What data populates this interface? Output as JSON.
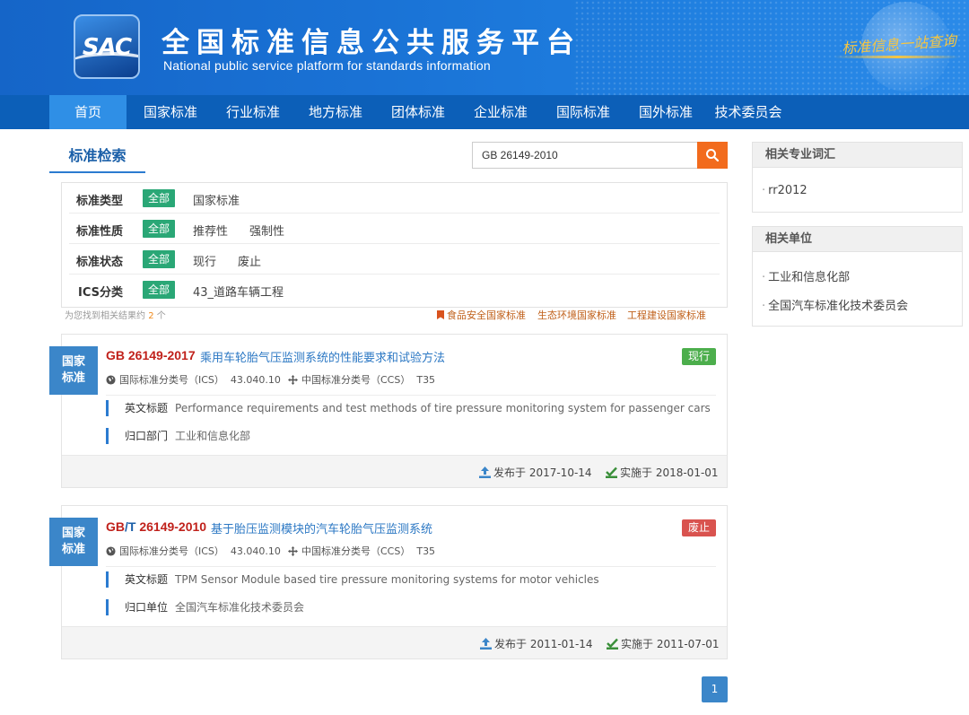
{
  "header": {
    "logo_text": "SAC",
    "title": "全国标准信息公共服务平台",
    "subtitle": "National public service platform  for standards information",
    "slogan": "标准信息一站查询"
  },
  "nav": {
    "items": [
      "首页",
      "国家标准",
      "行业标准",
      "地方标准",
      "团体标准",
      "企业标准",
      "国际标准",
      "国外标准",
      "技术委员会"
    ]
  },
  "search": {
    "tab_label": "标准检索",
    "query": "GB 26149-2010",
    "button_icon": "search-icon"
  },
  "filters": {
    "rows": [
      {
        "label": "标准类型",
        "all": "全部",
        "options": [
          "国家标准"
        ]
      },
      {
        "label": "标准性质",
        "all": "全部",
        "options": [
          "推荐性",
          "强制性"
        ]
      },
      {
        "label": "标准状态",
        "all": "全部",
        "options": [
          "现行",
          "废止"
        ]
      },
      {
        "label": "ICS分类",
        "all": "全部",
        "options": [
          "43_道路车辆工程"
        ]
      }
    ]
  },
  "results_summary": {
    "prefix": "为您找到相关结果约",
    "count": "2",
    "suffix": "个"
  },
  "quick_links": [
    "食品安全国家标准",
    "生态环境国家标准",
    "工程建设国家标准"
  ],
  "results": [
    {
      "badge": [
        "国家",
        "标准"
      ],
      "code_prefix": "GB",
      "code_rest": " 26149-2017",
      "title": "乘用车轮胎气压监测系统的性能要求和试验方法",
      "status": "现行",
      "ics_label": "国际标准分类号（ICS）",
      "ics_value": "43.040.10",
      "ccs_label": "中国标准分类号（CCS）",
      "ccs_value": "T35",
      "en_label": "英文标题",
      "en_value": "Performance requirements and test methods of tire pressure monitoring system for passenger cars",
      "dept_label": "归口部门",
      "dept_value": "工业和信息化部",
      "published": "发布于 2017-10-14",
      "effective": "实施于 2018-01-01"
    },
    {
      "badge": [
        "国家",
        "标准"
      ],
      "code_prefix": "GB/T",
      "code_rest": " 26149-2010",
      "title": "基于胎压监测模块的汽车轮胎气压监测系统",
      "status": "废止",
      "ics_label": "国际标准分类号（ICS）",
      "ics_value": "43.040.10",
      "ccs_label": "中国标准分类号（CCS）",
      "ccs_value": "T35",
      "en_label": "英文标题",
      "en_value": "TPM Sensor Module based tire pressure monitoring systems for motor vehicles",
      "dept_label": "归口单位",
      "dept_value": "全国汽车标准化技术委员会",
      "published": "发布于 2011-01-14",
      "effective": "实施于 2011-07-01"
    }
  ],
  "pagination": {
    "current": "1"
  },
  "sidebar": {
    "related_terms": {
      "title": "相关专业词汇",
      "items": [
        "rr2012"
      ]
    },
    "related_units": {
      "title": "相关单位",
      "items": [
        "工业和信息化部",
        "全国汽车标准化技术委员会"
      ]
    }
  },
  "colors": {
    "header_blue": "#1a73d6",
    "nav_blue": "#0c5fb8",
    "nav_active": "#2f8fe6",
    "filter_all_green": "#2aa776",
    "status_current": "#4cae4c",
    "status_abolished": "#d9534f",
    "code_red": "#c0211b",
    "search_orange": "#f26b1d"
  }
}
